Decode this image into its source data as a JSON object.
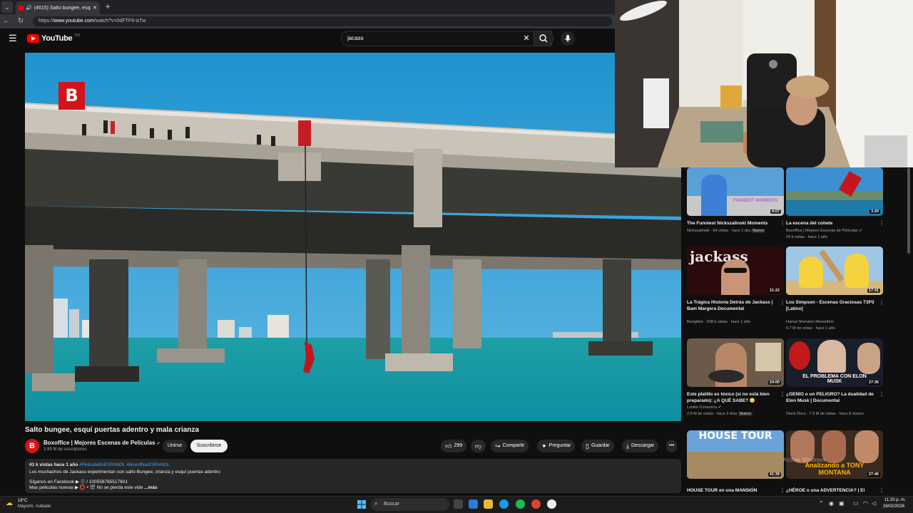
{
  "browser": {
    "tab_title": "(4615) Salto bungee, esquí pu",
    "url_prefix": "https://",
    "url_domain": "www.youtube.com",
    "url_path": "/watch?v=0dFTF8-isTw"
  },
  "youtube": {
    "logo_text": "YouTube",
    "country": "CO",
    "search_value": "jacass"
  },
  "video": {
    "watermark_letter": "B",
    "title": "Salto bungee, esquí puertas adentro y mala crianza",
    "channel": "Boxoffice | Mejores Escenas de Películas",
    "subscribers": "2.99 M de suscriptores",
    "join_label": "Unirse",
    "subscribe_label": "Suscribirse",
    "likes": "299",
    "share_label": "Compartir",
    "ask_label": "Preguntar",
    "save_label": "Guardar",
    "download_label": "Descargar",
    "more_label": "•••"
  },
  "description": {
    "stats": "41 k vistas  hace 1 año",
    "hashtags": "#PeliculaEnESPANOL #BoxofficeESPANOL",
    "line1": "Los muchachos de Jackass experimentan con salto Bungee, crianza y esquí puertas adentro",
    "line2": "Síganos en Facebook ▶ ⓕ / 100558765517601",
    "line3": "Mas peliculas nuevas ▶ ⭕ • 🎬 No se pierda este vide",
    "more": "...más"
  },
  "recommendations": [
    {
      "title": "The Funniest Nickszalinski Moments",
      "meta1": "Nickszalinski · 54 vistas · hace 1 día",
      "badge": "Nuevo",
      "meta2": "",
      "duration": "4:07",
      "thumb_text": "FUNNIEST MOMENTS"
    },
    {
      "title": "La escena del cohete",
      "meta1": "Boxoffice | Mejores Escenas de Películas",
      "badge": "",
      "meta2": "24 k vistas · hace 1 año",
      "duration": "3:20",
      "thumb_text": ""
    },
    {
      "title": "La Trágica Historia Detrás de Jackass | Bam Margera Documental",
      "meta1": "Bengidos · 538 k vistas · hace 1 año",
      "badge": "",
      "meta2": "",
      "duration": "21:22",
      "thumb_text": "jackass"
    },
    {
      "title": "Los Simpson - Escenas Graciosas T3P3 [Latino]",
      "meta1": "Hamal Sheraton Mesarthim",
      "badge": "",
      "meta2": "6.7 M de vistas · hace 1 año",
      "duration": "17:41",
      "thumb_text": ""
    },
    {
      "title": "Este platillo es tóxico (si no está bien preparado): ¿A QUÉ SABE? 😳",
      "meta1": "Luisito Comunica",
      "badge": "Nuevo",
      "meta2": "2.6 M de vistas · hace 2 días",
      "duration": "24:00",
      "thumb_text": ""
    },
    {
      "title": "¿GENIO o un PELIGRO? La dualidad de Elon Musk | Documental",
      "meta1": "Dieck Docs · 7.6 M de vistas · hace 8 meses",
      "badge": "",
      "meta2": "",
      "duration": "27:36",
      "thumb_text": "EL PROBLEMA CON ELON MUSK"
    },
    {
      "title": "HOUSE TOUR en una MANSIÓN",
      "meta1": "",
      "badge": "",
      "meta2": "",
      "duration": "41:39",
      "thumb_text": "HOUSE TOUR"
    },
    {
      "title": "¿HÉROE o una ADVERTENCIA? | El",
      "meta1": "",
      "badge": "",
      "meta2": "",
      "duration": "27:46",
      "thumb_text": "Analizando a TONY MONTANA"
    }
  ],
  "windows_watermark": "Activar Windows",
  "taskbar": {
    "temperature": "18°C",
    "weather": "Mayorm. nublado",
    "search_label": "Buscar",
    "time": "11:20 p. m.",
    "date": "26/02/2026"
  },
  "colors": {
    "yt_red": "#ff0000",
    "channel_red": "#d3141b",
    "background": "#0f0f0f",
    "link_blue": "#3ea6ff"
  }
}
